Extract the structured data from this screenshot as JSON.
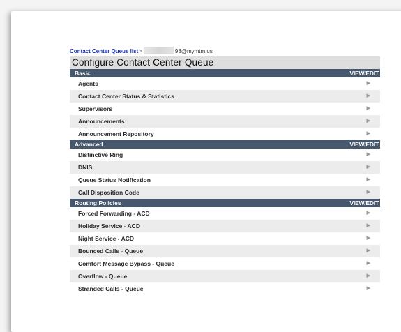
{
  "breadcrumb": {
    "link": "Contact Center Queue list",
    "separator": ">",
    "queue_suffix": "93@mymtm.us"
  },
  "page_title": "Configure Contact Center Queue",
  "sections": [
    {
      "title": "Basic",
      "action": "VIEW/EDIT",
      "items": [
        "Agents",
        "Contact Center Status & Statistics",
        "Supervisors",
        "Announcements",
        "Announcement Repository"
      ]
    },
    {
      "title": "Advanced",
      "action": "VIEW/EDIT",
      "items": [
        "Distinctive Ring",
        "DNIS",
        "Queue Status Notification",
        "Call Disposition Code"
      ]
    },
    {
      "title": "Routing Policies",
      "action": "VIEW/EDIT",
      "items": [
        "Forced Forwarding - ACD",
        "Holiday Service - ACD",
        "Night Service - ACD",
        "Bounced Calls - Queue",
        "Comfort Message Bypass - Queue",
        "Overflow - Queue",
        "Stranded Calls - Queue"
      ]
    }
  ],
  "arrow_glyph": "▶",
  "colors": {
    "header_bg": "#46586e",
    "title_bg": "#dedede",
    "link": "#1a32b8",
    "stripe": "#ececec"
  }
}
